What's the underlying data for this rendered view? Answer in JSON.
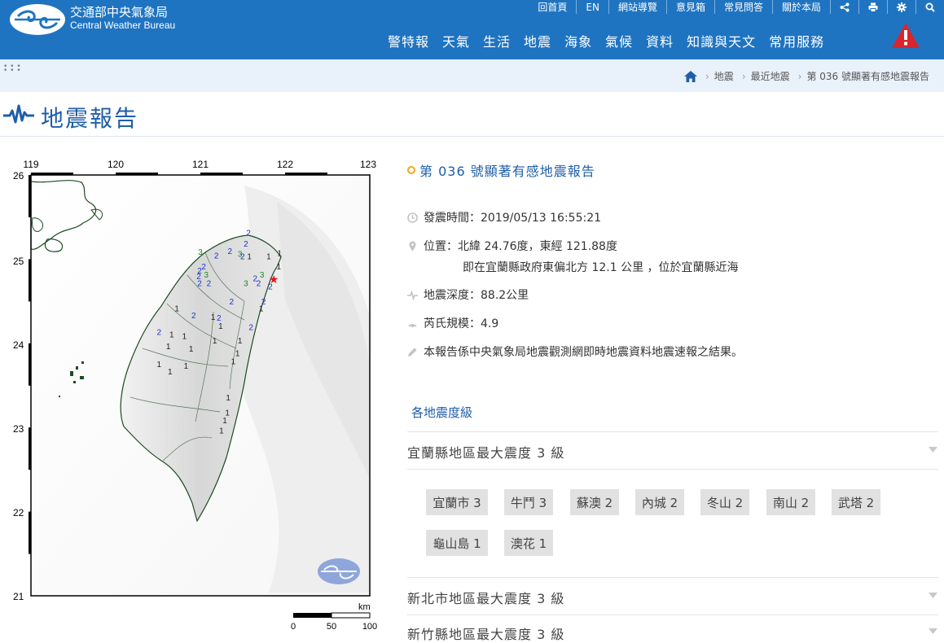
{
  "header": {
    "org_zh": "交通部中央氣象局",
    "org_en": "Central Weather Bureau",
    "top_links": [
      "回首頁",
      "EN",
      "網站導覽",
      "意見箱",
      "常見問答",
      "關於本局"
    ],
    "top_icons": [
      "share-icon",
      "print-icon",
      "gear-icon",
      "search-icon"
    ],
    "nav": [
      "警特報",
      "天氣",
      "生活",
      "地震",
      "海象",
      "氣候",
      "資料",
      "知識與天文",
      "常用服務"
    ],
    "alert_icon": "warning-icon"
  },
  "breadcrumb": {
    "home_icon": "home-icon",
    "items": [
      "地震",
      "最近地震",
      "第 036 號顯著有感地震報告"
    ]
  },
  "page_title": "地震報告",
  "map": {
    "lon_ticks": [
      "119",
      "120",
      "121",
      "122",
      "123"
    ],
    "lat_ticks": [
      "26",
      "25",
      "24",
      "23",
      "22",
      "21"
    ],
    "scale_unit": "km",
    "scale_ticks": [
      "0",
      "50",
      "100"
    ],
    "epicenter_marker": "star",
    "intensity_colors": {
      "1": "#222222",
      "2": "#1c34c8",
      "3": "#1a8a1a"
    },
    "epicenter_color": "#e8141b",
    "stations": [
      {
        "v": "2",
        "lon": 121.58,
        "lat": 25.28
      },
      {
        "v": "2",
        "lon": 121.55,
        "lat": 25.15
      },
      {
        "v": "2",
        "lon": 121.36,
        "lat": 25.06
      },
      {
        "v": "3",
        "lon": 121.48,
        "lat": 25.03
      },
      {
        "v": "2",
        "lon": 121.2,
        "lat": 25.01
      },
      {
        "v": "3",
        "lon": 121.01,
        "lat": 25.05
      },
      {
        "v": "2",
        "lon": 121.51,
        "lat": 25.0
      },
      {
        "v": "1",
        "lon": 121.59,
        "lat": 25.0
      },
      {
        "v": "1",
        "lon": 121.82,
        "lat": 25.0
      },
      {
        "v": "1",
        "lon": 121.95,
        "lat": 25.04
      },
      {
        "v": "1",
        "lon": 121.94,
        "lat": 24.88
      },
      {
        "v": "2",
        "lon": 121.05,
        "lat": 24.88
      },
      {
        "v": "3",
        "lon": 121.08,
        "lat": 24.78
      },
      {
        "v": "2",
        "lon": 121.0,
        "lat": 24.83
      },
      {
        "v": "2",
        "lon": 121.0,
        "lat": 24.68
      },
      {
        "v": "2",
        "lon": 121.11,
        "lat": 24.68
      },
      {
        "v": "2",
        "lon": 121.66,
        "lat": 24.74
      },
      {
        "v": "3",
        "lon": 121.74,
        "lat": 24.78
      },
      {
        "v": "2",
        "lon": 121.7,
        "lat": 24.68
      },
      {
        "v": "3",
        "lon": 121.55,
        "lat": 24.68
      },
      {
        "v": "2",
        "lon": 121.84,
        "lat": 24.64
      },
      {
        "v": "2",
        "lon": 121.38,
        "lat": 24.46
      },
      {
        "v": "2",
        "lon": 121.76,
        "lat": 24.46
      },
      {
        "v": "1",
        "lon": 121.73,
        "lat": 24.38
      },
      {
        "v": "1",
        "lon": 120.73,
        "lat": 24.38
      },
      {
        "v": "2",
        "lon": 120.93,
        "lat": 24.3
      },
      {
        "v": "1",
        "lon": 121.16,
        "lat": 24.28
      },
      {
        "v": "2",
        "lon": 121.23,
        "lat": 24.27
      },
      {
        "v": "1",
        "lon": 121.25,
        "lat": 24.17
      },
      {
        "v": "2",
        "lon": 121.61,
        "lat": 24.16
      },
      {
        "v": "2",
        "lon": 120.52,
        "lat": 24.1
      },
      {
        "v": "1",
        "lon": 120.67,
        "lat": 24.07
      },
      {
        "v": "1",
        "lon": 120.82,
        "lat": 24.05
      },
      {
        "v": "1",
        "lon": 121.18,
        "lat": 24.0
      },
      {
        "v": "1",
        "lon": 121.48,
        "lat": 24.0
      },
      {
        "v": "1",
        "lon": 120.63,
        "lat": 23.93
      },
      {
        "v": "1",
        "lon": 120.9,
        "lat": 23.9
      },
      {
        "v": "1",
        "lon": 121.45,
        "lat": 23.85
      },
      {
        "v": "1",
        "lon": 120.52,
        "lat": 23.72
      },
      {
        "v": "1",
        "lon": 120.84,
        "lat": 23.7
      },
      {
        "v": "1",
        "lon": 121.4,
        "lat": 23.75
      },
      {
        "v": "1",
        "lon": 120.65,
        "lat": 23.63
      },
      {
        "v": "1",
        "lon": 121.34,
        "lat": 23.32
      },
      {
        "v": "1",
        "lon": 121.33,
        "lat": 23.14
      },
      {
        "v": "1",
        "lon": 121.3,
        "lat": 23.05
      },
      {
        "v": "1",
        "lon": 121.26,
        "lat": 22.93
      },
      {
        "v": "2",
        "lon": 120.99,
        "lat": 24.76
      }
    ],
    "epicenter": {
      "lon": 121.88,
      "lat": 24.76
    }
  },
  "report": {
    "title": "第 036 號顯著有感地震報告",
    "time": "發震時間：2019/05/13 16:55:21",
    "location": "位置：北緯 24.76度，東經 121.88度",
    "location_sub": "即在宜蘭縣政府東偏北方 12.1 公里 ，位於宜蘭縣近海",
    "depth": "地震深度：88.2公里",
    "magnitude": "芮氏規模：4.9",
    "note": "本報告係中央氣象局地震觀測網即時地震資料地震速報之結果。"
  },
  "levels": {
    "link": "各地震度級",
    "regions": [
      {
        "title": "宜蘭縣地區最大震度 3 級",
        "stations": [
          "宜蘭市 3",
          "牛鬥 3",
          "蘇澳 2",
          "內城 2",
          "冬山 2",
          "南山 2",
          "武塔 2",
          "龜山島 1",
          "澳花 1"
        ]
      },
      {
        "title": "新北市地區最大震度 3 級",
        "stations": []
      },
      {
        "title": "新竹縣地區最大震度 3 級",
        "stations": []
      }
    ]
  }
}
